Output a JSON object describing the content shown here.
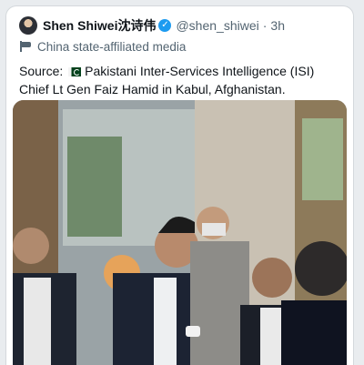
{
  "tweet": {
    "author_name": "Shen Shiwei沈诗伟",
    "handle": "@shen_shiwei",
    "separator": "·",
    "time": "3h",
    "affiliation": "China state-affiliated media",
    "text_prefix": "Source: ",
    "text_main": "Pakistani Inter-Services Intelligence (ISI) Chief Lt Gen Faiz Hamid in Kabul, Afghanistan.",
    "verified_glyph": "✓"
  },
  "icons": {
    "verified": "verified-badge-icon",
    "affiliation": "flag-icon",
    "pakistan_flag": "pakistan-flag-emoji"
  },
  "colors": {
    "name": "#0f1419",
    "secondary": "#536471",
    "verified": "#1d9bf0"
  }
}
